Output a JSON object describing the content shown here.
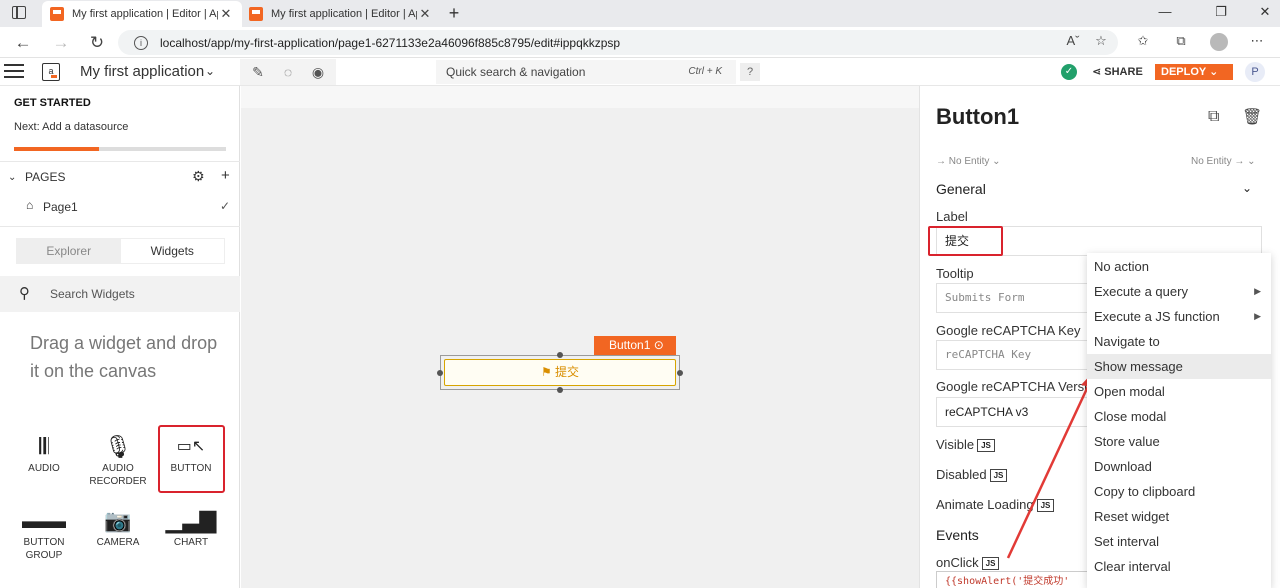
{
  "browser": {
    "tabs": [
      {
        "title": "My first application | Editor | App",
        "active": true
      },
      {
        "title": "My first application | Editor | App",
        "active": false
      }
    ],
    "url": "localhost/app/my-first-application/page1-6271133e2a46096f885c8795/edit#ippqkkzpsp"
  },
  "header": {
    "app_name": "My first application",
    "quick_search": "Quick search & navigation",
    "shortcut": "Ctrl + K",
    "help": "?",
    "share": "SHARE",
    "deploy": "DEPLOY",
    "avatar": "P"
  },
  "left": {
    "get_started": "GET STARTED",
    "next": "Next: Add a datasource",
    "progress": 0.4,
    "pages_label": "PAGES",
    "page1": "Page1",
    "tabs": [
      "Explorer",
      "Widgets"
    ],
    "active_tab": "Widgets",
    "search_placeholder": "Search Widgets",
    "drag_hint": "Drag a widget and drop it on the canvas",
    "widgets": [
      {
        "label": "AUDIO",
        "icon": "audio-icon"
      },
      {
        "label": "AUDIO RECORDER",
        "icon": "microphone-icon"
      },
      {
        "label": "BUTTON",
        "icon": "button-icon"
      },
      {
        "label": "BUTTON GROUP",
        "icon": "button-group-icon"
      },
      {
        "label": "CAMERA",
        "icon": "camera-icon"
      },
      {
        "label": "CHART",
        "icon": "chart-icon"
      }
    ]
  },
  "canvas": {
    "widget_tag": "Button1",
    "button_label": "提交"
  },
  "props": {
    "title": "Button1",
    "no_entity_left": "→ No Entity ⌄",
    "no_entity_right": "No Entity → ⌄",
    "general": "General",
    "label_label": "Label",
    "label_value": "提交",
    "tooltip_label": "Tooltip",
    "tooltip_placeholder": "Submits Form",
    "recaptcha_key_label": "Google reCAPTCHA Key",
    "recaptcha_key_placeholder": "reCAPTCHA Key",
    "recaptcha_version_label": "Google reCAPTCHA Version",
    "recaptcha_version_value": "reCAPTCHA v3",
    "visible_label": "Visible",
    "disabled_label": "Disabled",
    "animate_label": "Animate Loading",
    "js": "JS",
    "events": "Events",
    "onclick_label": "onClick",
    "onclick_code": "{{showAlert('提交成功'"
  },
  "action_menu": {
    "items": [
      "No action",
      "Execute a query",
      "Execute a JS function",
      "Navigate to",
      "Show message",
      "Open modal",
      "Close modal",
      "Store value",
      "Download",
      "Copy to clipboard",
      "Reset widget",
      "Set interval",
      "Clear interval"
    ],
    "selected": "Show message"
  },
  "colors": {
    "accent": "#f26622",
    "highlight": "#d9232d",
    "success": "#22a06b"
  }
}
